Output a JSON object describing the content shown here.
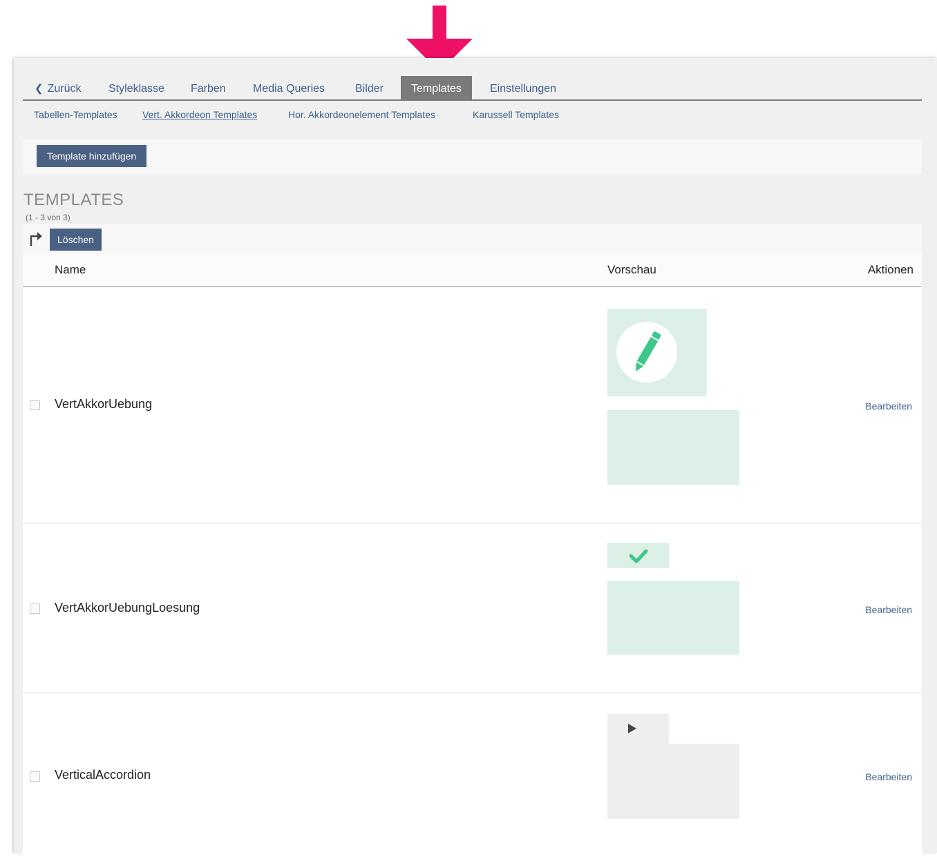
{
  "tabs": [
    {
      "label": "Zurück",
      "icon": "chevron-left-icon"
    },
    {
      "label": "Styleklasse"
    },
    {
      "label": "Farben"
    },
    {
      "label": "Media Queries"
    },
    {
      "label": "Bilder"
    },
    {
      "label": "Templates",
      "active": true
    },
    {
      "label": "Einstellungen"
    }
  ],
  "subtabs": [
    {
      "label": "Tabellen-Templates"
    },
    {
      "label": "Vert. Akkordeon Templates",
      "active": true
    },
    {
      "label": "Hor. Akkordeonelement Templates"
    },
    {
      "label": "Karussell Templates"
    }
  ],
  "toolbar": {
    "add_label": "Template hinzufügen"
  },
  "section": {
    "title": "TEMPLATES",
    "count": "(1 - 3 von 3)"
  },
  "actions": {
    "delete_label": "Löschen",
    "select_icon": "turn-right-arrow-icon"
  },
  "table": {
    "headers": {
      "name": "Name",
      "preview": "Vorschau",
      "actions": "Aktionen"
    },
    "rows": [
      {
        "name": "VertAkkorUebung",
        "action": "Bearbeiten",
        "preview_icon": "pencil-icon"
      },
      {
        "name": "VertAkkorUebungLoesung",
        "action": "Bearbeiten",
        "preview_icon": "checkmark-icon"
      },
      {
        "name": "VerticalAccordion",
        "action": "Bearbeiten",
        "preview_icon": "play-triangle-icon"
      }
    ]
  },
  "colors": {
    "annotation_arrow": "#ee1166",
    "tab_text": "#3d5f8c",
    "active_tab_bg": "#7a7a7a",
    "button_bg": "#4a6184",
    "preview_mint": "#dcf0e8",
    "icon_green": "#3cc88a"
  }
}
